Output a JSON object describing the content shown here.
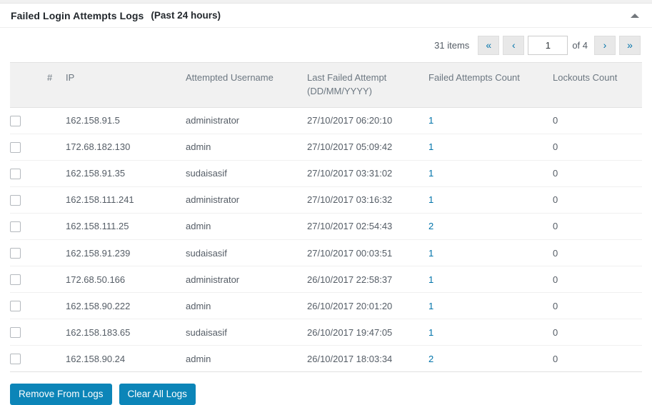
{
  "panel": {
    "title": "Failed Login Attempts Logs",
    "subtitle": "(Past 24 hours)",
    "toggle_icon": "chevron-up-icon"
  },
  "pagination": {
    "items_label": "31 items",
    "first_label": "«",
    "prev_label": "‹",
    "current_page": "1",
    "total_label": "of 4",
    "next_label": "›",
    "last_label": "»"
  },
  "table": {
    "columns": {
      "num": "#",
      "ip": "IP",
      "username": "Attempted Username",
      "date_line1": "Last Failed Attempt",
      "date_line2": "(DD/MM/YYYY)",
      "failed_count": "Failed Attempts Count",
      "lockouts_count": "Lockouts Count"
    },
    "rows": [
      {
        "ip": "162.158.91.5",
        "username": "administrator",
        "last_failed": "27/10/2017 06:20:10",
        "failed": "1",
        "lockouts": "0"
      },
      {
        "ip": "172.68.182.130",
        "username": "admin",
        "last_failed": "27/10/2017 05:09:42",
        "failed": "1",
        "lockouts": "0"
      },
      {
        "ip": "162.158.91.35",
        "username": "sudaisasif",
        "last_failed": "27/10/2017 03:31:02",
        "failed": "1",
        "lockouts": "0"
      },
      {
        "ip": "162.158.111.241",
        "username": "administrator",
        "last_failed": "27/10/2017 03:16:32",
        "failed": "1",
        "lockouts": "0"
      },
      {
        "ip": "162.158.111.25",
        "username": "admin",
        "last_failed": "27/10/2017 02:54:43",
        "failed": "2",
        "lockouts": "0"
      },
      {
        "ip": "162.158.91.239",
        "username": "sudaisasif",
        "last_failed": "27/10/2017 00:03:51",
        "failed": "1",
        "lockouts": "0"
      },
      {
        "ip": "172.68.50.166",
        "username": "administrator",
        "last_failed": "26/10/2017 22:58:37",
        "failed": "1",
        "lockouts": "0"
      },
      {
        "ip": "162.158.90.222",
        "username": "admin",
        "last_failed": "26/10/2017 20:01:20",
        "failed": "1",
        "lockouts": "0"
      },
      {
        "ip": "162.158.183.65",
        "username": "sudaisasif",
        "last_failed": "26/10/2017 19:47:05",
        "failed": "1",
        "lockouts": "0"
      },
      {
        "ip": "162.158.90.24",
        "username": "admin",
        "last_failed": "26/10/2017 18:03:34",
        "failed": "2",
        "lockouts": "0"
      }
    ]
  },
  "footer": {
    "remove_label": "Remove From Logs",
    "clear_label": "Clear All Logs"
  },
  "colors": {
    "accent": "#0c85b8",
    "link": "#0073aa",
    "header_bg": "#f1f1f1"
  }
}
